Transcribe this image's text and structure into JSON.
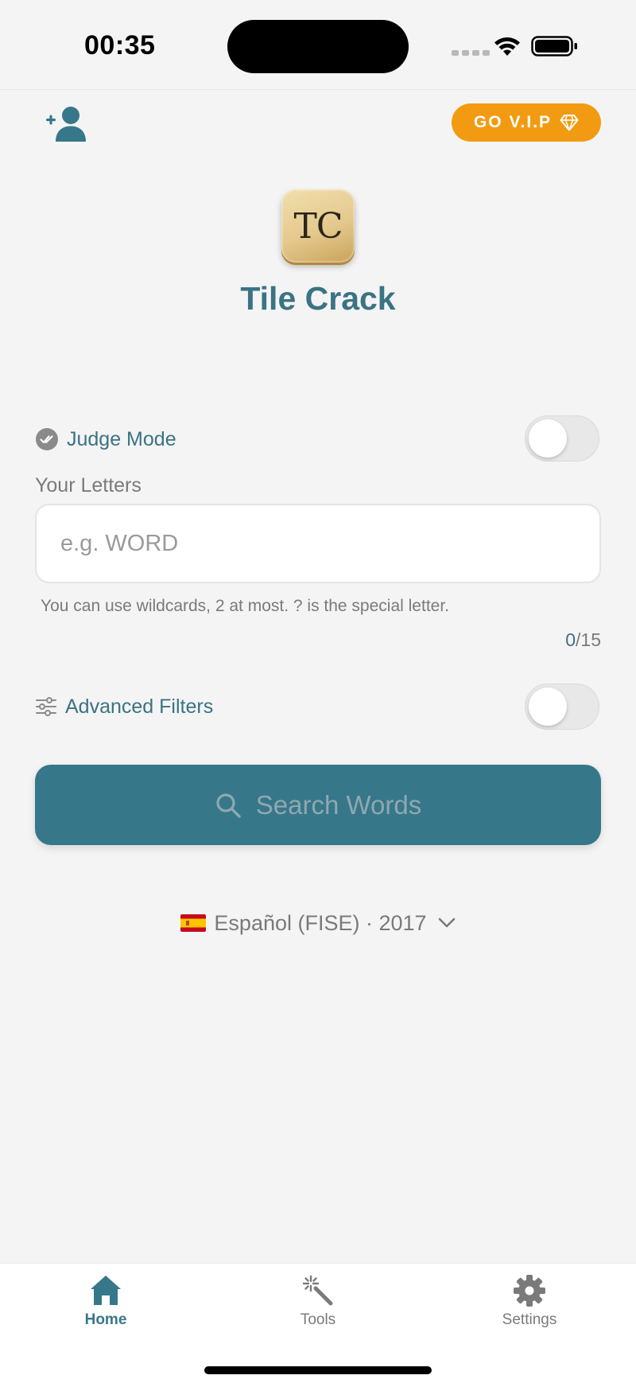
{
  "status_bar": {
    "time": "00:35",
    "icons": [
      "cellular-dots-icon",
      "wifi-icon",
      "battery-icon"
    ]
  },
  "header": {
    "add_user_icon": "add-user-icon",
    "vip_button_label": "GO V.I.P",
    "vip_icon": "diamond-icon"
  },
  "app": {
    "logo_text": "TC",
    "title": "Tile Crack"
  },
  "judge_mode": {
    "label": "Judge Mode",
    "enabled": false
  },
  "letters": {
    "label": "Your Letters",
    "value": "",
    "placeholder": "e.g. WORD",
    "helper": "You can use wildcards, 2 at most. ? is the special letter.",
    "count": "0",
    "max": "/15"
  },
  "advanced_filters": {
    "label": "Advanced Filters",
    "enabled": false
  },
  "search_button": {
    "label": "Search Words"
  },
  "language": {
    "flag": "spain-flag-icon",
    "label": "Español (FISE) · 2017"
  },
  "tab_bar": {
    "tabs": [
      {
        "label": "Home",
        "icon": "home-icon",
        "active": true
      },
      {
        "label": "Tools",
        "icon": "magic-wand-icon",
        "active": false
      },
      {
        "label": "Settings",
        "icon": "gear-icon",
        "active": false
      }
    ]
  },
  "colors": {
    "accent": "#37778a",
    "vip": "#f29b12",
    "background": "#f4f4f4"
  }
}
